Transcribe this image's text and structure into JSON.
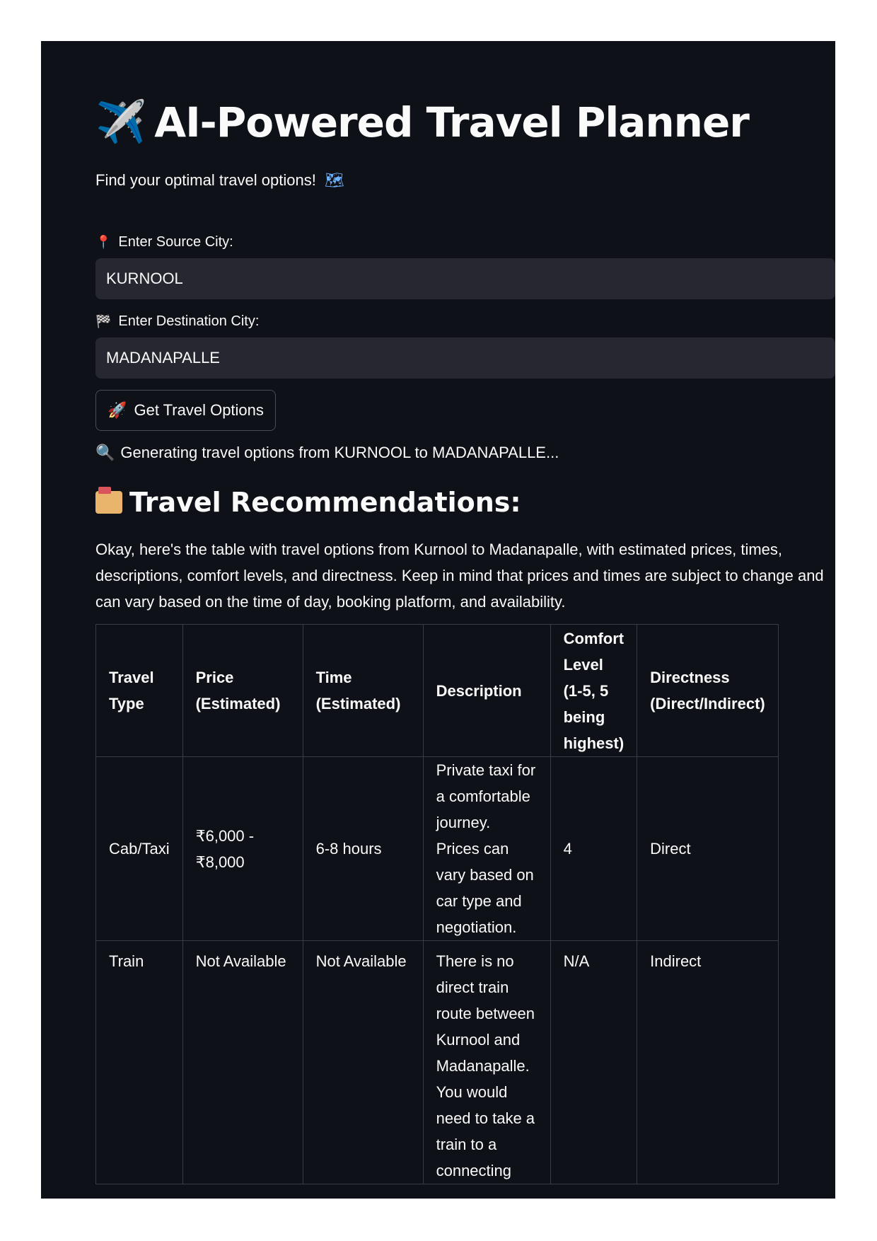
{
  "header": {
    "title_icon": "airplane-icon",
    "title": "AI-Powered Travel Planner",
    "subtitle": "Find your optimal travel options!",
    "subtitle_icon": "map-icon"
  },
  "form": {
    "source_label": "Enter Source City:",
    "source_icon": "pin-icon",
    "source_value": "KURNOOL",
    "destination_label": "Enter Destination City:",
    "destination_icon": "checkered-flag-icon",
    "destination_value": "MADANAPALLE",
    "button_label": "Get Travel Options",
    "button_icon": "rocket-icon"
  },
  "status": {
    "icon": "magnifier-icon",
    "text": "Generating travel options from KURNOOL to MADANAPALLE..."
  },
  "results": {
    "heading_icon": "card-file-box-icon",
    "heading": "Travel Recommendations:",
    "intro": "Okay, here's the table with travel options from Kurnool to Madanapalle, with estimated prices, times, descriptions, comfort levels, and directness. Keep in mind that prices and times are subject to change and can vary based on the time of day, booking platform, and availability.",
    "table": {
      "headers": [
        "Travel Type",
        "Price (Estimated)",
        "Time (Estimated)",
        "Description",
        "Comfort Level (1-5, 5 being highest)",
        "Directness (Direct/Indirect)"
      ],
      "rows": [
        [
          "Cab/Taxi",
          "₹6,000 - ₹8,000",
          "6-8 hours",
          "Private taxi for a comfortable journey. Prices can vary based on car type and negotiation.",
          "4",
          "Direct"
        ],
        [
          "Train",
          "Not Available",
          "Not Available",
          "There is no direct train route between Kurnool and Madanapalle. You would need to take a train to a connecting",
          "N/A",
          "Indirect"
        ]
      ]
    }
  },
  "colors": {
    "background": "#0e1117",
    "input_background": "#262730",
    "text": "#fafafa",
    "border": "#3a3c45"
  }
}
